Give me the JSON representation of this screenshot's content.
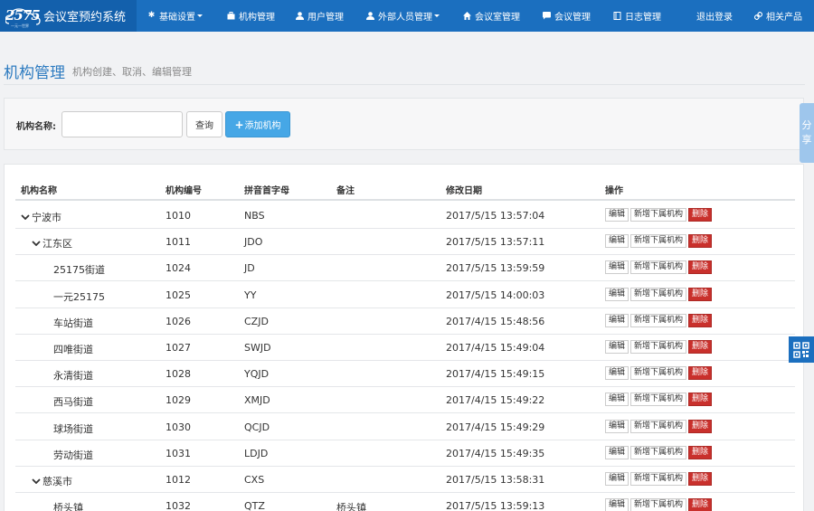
{
  "app": {
    "logo_text": "2575",
    "logo_sub": "一元一世界",
    "title": "会议室预约系统"
  },
  "nav": [
    {
      "label": "基础设置",
      "icon": "gear-icon",
      "dropdown": true
    },
    {
      "label": "机构管理",
      "icon": "briefcase-icon",
      "dropdown": false
    },
    {
      "label": "用户管理",
      "icon": "user-icon",
      "dropdown": false
    },
    {
      "label": "外部人员管理",
      "icon": "user-icon",
      "dropdown": true
    },
    {
      "label": "会议室管理",
      "icon": "home-icon",
      "dropdown": false
    },
    {
      "label": "会议管理",
      "icon": "comment-icon",
      "dropdown": false
    },
    {
      "label": "日志管理",
      "icon": "book-icon",
      "dropdown": false
    },
    {
      "label": "退出登录",
      "icon": "",
      "dropdown": false
    },
    {
      "label": "相关产品",
      "icon": "link-icon",
      "dropdown": false
    }
  ],
  "page": {
    "title": "机构管理",
    "subtitle": "机构创建、取消、编辑管理"
  },
  "search": {
    "label": "机构名称:",
    "value": "",
    "placeholder": "",
    "query_label": "查询",
    "add_label": "添加机构",
    "add_icon": "plus-icon"
  },
  "table": {
    "columns": [
      "机构名称",
      "机构编号",
      "拼音首字母",
      "备注",
      "修改日期",
      "操作"
    ],
    "actions": {
      "edit": "编辑",
      "add_child": "新增下属机构",
      "delete": "删除"
    },
    "rows": [
      {
        "name": "宁波市",
        "code": "1010",
        "pinyin": "NBS",
        "note": "",
        "date": "2017/5/15 13:57:04",
        "level": 0,
        "expanded": true
      },
      {
        "name": "江东区",
        "code": "1011",
        "pinyin": "JDO",
        "note": "",
        "date": "2017/5/15 13:57:11",
        "level": 1,
        "expanded": true
      },
      {
        "name": "25175街道",
        "code": "1024",
        "pinyin": "JD",
        "note": "",
        "date": "2017/5/15 13:59:59",
        "level": 2,
        "expanded": false
      },
      {
        "name": "一元25175",
        "code": "1025",
        "pinyin": "YY",
        "note": "",
        "date": "2017/5/15 14:00:03",
        "level": 2,
        "expanded": false
      },
      {
        "name": "车站街道",
        "code": "1026",
        "pinyin": "CZJD",
        "note": "",
        "date": "2017/4/15 15:48:56",
        "level": 2,
        "expanded": false
      },
      {
        "name": "四唯街道",
        "code": "1027",
        "pinyin": "SWJD",
        "note": "",
        "date": "2017/4/15 15:49:04",
        "level": 2,
        "expanded": false
      },
      {
        "name": "永清街道",
        "code": "1028",
        "pinyin": "YQJD",
        "note": "",
        "date": "2017/4/15 15:49:15",
        "level": 2,
        "expanded": false
      },
      {
        "name": "西马街道",
        "code": "1029",
        "pinyin": "XMJD",
        "note": "",
        "date": "2017/4/15 15:49:22",
        "level": 2,
        "expanded": false
      },
      {
        "name": "球场街道",
        "code": "1030",
        "pinyin": "QCJD",
        "note": "",
        "date": "2017/4/15 15:49:29",
        "level": 2,
        "expanded": false
      },
      {
        "name": "劳动街道",
        "code": "1031",
        "pinyin": "LDJD",
        "note": "",
        "date": "2017/4/15 15:49:35",
        "level": 2,
        "expanded": false
      },
      {
        "name": "慈溪市",
        "code": "1012",
        "pinyin": "CXS",
        "note": "",
        "date": "2017/5/15 13:58:31",
        "level": 1,
        "expanded": true
      },
      {
        "name": "桥头镇",
        "code": "1032",
        "pinyin": "QTZ",
        "note": "桥头镇",
        "date": "2017/5/15 13:59:13",
        "level": 2,
        "expanded": false
      }
    ]
  },
  "share": {
    "label": "分享"
  },
  "qr": {
    "icon": "qrcode-icon"
  }
}
